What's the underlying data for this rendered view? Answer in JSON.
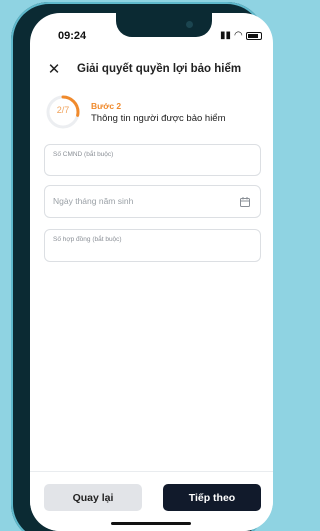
{
  "status_bar": {
    "time": "09:24"
  },
  "header": {
    "title": "Giải quyết quyền lợi bảo hiểm",
    "close_icon": "close-icon"
  },
  "progress": {
    "text": "2/7",
    "fraction": 0.2857,
    "step_label": "Bước 2",
    "step_desc": "Thông tin người được bảo hiểm"
  },
  "form": {
    "id_field": {
      "label": "Số CMND (bắt buộc)",
      "value": ""
    },
    "dob_field": {
      "placeholder": "Ngày tháng năm sinh",
      "icon": "calendar-icon"
    },
    "contract_field": {
      "label": "Số hợp đồng (bắt buộc)",
      "value": ""
    }
  },
  "footer": {
    "back_label": "Quay lại",
    "next_label": "Tiếp theo"
  },
  "colors": {
    "accent": "#f08a2c",
    "primary_button": "#111a2b",
    "secondary_button": "#e2e4e8",
    "background": "#8fd3e2"
  }
}
